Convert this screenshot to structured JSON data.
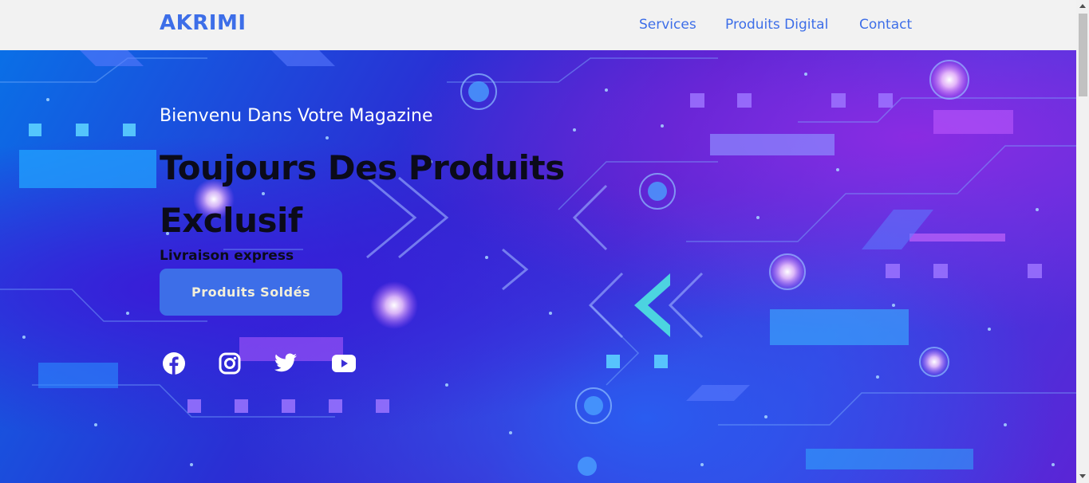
{
  "nav": {
    "brand": "AKRIMI",
    "links": [
      "Services",
      "Produits Digital",
      "Contact"
    ]
  },
  "hero": {
    "greeting": "Bienvenu Dans Votre Magazine",
    "headline": "Toujours Des Produits Exclusif",
    "tagline": "Livraison express",
    "cta_label": "Produits Soldés"
  },
  "social": [
    "facebook-icon",
    "instagram-icon",
    "twitter-icon",
    "youtube-icon"
  ],
  "colors": {
    "accent": "#3d6ee8",
    "nav_bg": "#f2f2f2",
    "headline": "#0b0b1a"
  }
}
